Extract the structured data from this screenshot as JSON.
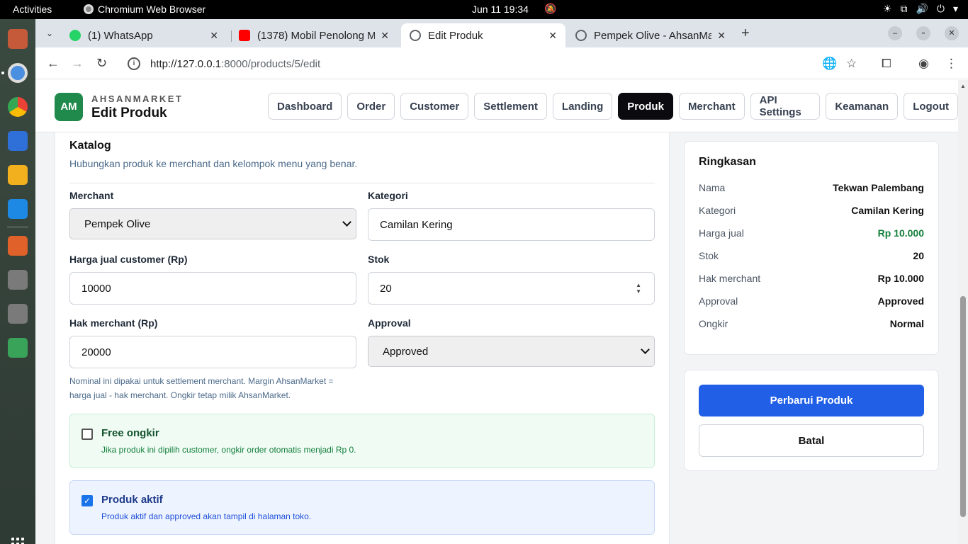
{
  "os": {
    "activities": "Activities",
    "app_name": "Chromium Web Browser",
    "clock": "Jun 11  19:34"
  },
  "browser": {
    "tabs": [
      {
        "title": "(1) WhatsApp",
        "icon": "whatsapp-icon",
        "color": "#25D366"
      },
      {
        "title": "(1378) Mobil Penolong M",
        "icon": "youtube-icon",
        "color": "#FF0000"
      },
      {
        "title": "Edit Produk",
        "icon": "globe-icon",
        "color": "#5f6368"
      },
      {
        "title": "Pempek Olive - AhsanMa",
        "icon": "globe-icon",
        "color": "#5f6368"
      }
    ],
    "url_host": "http://127.0.0.1",
    "url_rest": ":8000/products/5/edit"
  },
  "header": {
    "logo": "AM",
    "brand": "AHSANMARKET",
    "title": "Edit Produk",
    "nav": [
      "Dashboard",
      "Order",
      "Customer",
      "Settlement",
      "Landing",
      "Produk",
      "Merchant",
      "API Settings",
      "Keamanan",
      "Logout"
    ],
    "active_nav": "Produk"
  },
  "form": {
    "section_title": "Katalog",
    "section_sub": "Hubungkan produk ke merchant dan kelompok menu yang benar.",
    "merchant_label": "Merchant",
    "merchant_value": "Pempek Olive",
    "kategori_label": "Kategori",
    "kategori_value": "Camilan Kering",
    "harga_label": "Harga jual customer (Rp)",
    "harga_value": "10000",
    "stok_label": "Stok",
    "stok_value": "20",
    "hak_label": "Hak merchant (Rp)",
    "hak_value": "20000",
    "approval_label": "Approval",
    "approval_value": "Approved",
    "hint_line1": "Nominal ini dipakai untuk settlement merchant. Margin AhsanMarket =",
    "hint_line2": "harga jual - hak merchant. Ongkir tetap milik AhsanMarket.",
    "free_ongkir_title": "Free ongkir",
    "free_ongkir_desc": "Jika produk ini dipilih customer, ongkir order otomatis menjadi Rp 0.",
    "free_ongkir_checked": false,
    "aktif_title": "Produk aktif",
    "aktif_desc": "Produk aktif dan approved akan tampil di halaman toko.",
    "aktif_checked": true
  },
  "summary": {
    "title": "Ringkasan",
    "rows": [
      {
        "k": "Nama",
        "v": "Tekwan Palembang"
      },
      {
        "k": "Kategori",
        "v": "Camilan Kering"
      },
      {
        "k": "Harga jual",
        "v": "Rp 10.000"
      },
      {
        "k": "Stok",
        "v": "20"
      },
      {
        "k": "Hak merchant",
        "v": "Rp 10.000"
      },
      {
        "k": "Approval",
        "v": "Approved"
      },
      {
        "k": "Ongkir",
        "v": "Normal"
      }
    ]
  },
  "actions": {
    "primary": "Perbarui Produk",
    "secondary": "Batal"
  },
  "colors": {
    "primary": "#2160e6",
    "brand_green": "#1f8a4c",
    "price_green": "#15803d"
  }
}
